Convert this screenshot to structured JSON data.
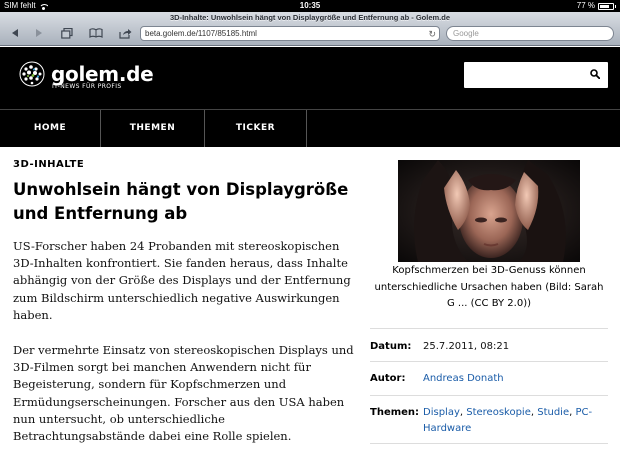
{
  "status_bar": {
    "carrier": "SIM fehlt",
    "time": "10:35",
    "battery_percent": "77 %",
    "battery_level": 0.77,
    "icons": [
      "wifi-icon",
      "battery-icon"
    ]
  },
  "browser": {
    "page_title": "3D-Inhalte: Unwohlsein hängt von Displaygröße und Entfernung ab - Golem.de",
    "url": "beta.golem.de/1107/85185.html",
    "search_placeholder": "Google",
    "buttons": [
      "back-icon",
      "forward-icon",
      "tabs-icon",
      "bookmarks-icon",
      "share-icon",
      "reload-icon"
    ]
  },
  "site": {
    "logo_text": "golem.de",
    "tagline": "IT-NEWS FÜR PROFIS",
    "nav": [
      {
        "label": "HOME"
      },
      {
        "label": "THEMEN"
      },
      {
        "label": "TICKER"
      }
    ],
    "colors": {
      "header_bg": "#000000",
      "link": "#1a5ca8"
    }
  },
  "article": {
    "kicker": "3D-INHALTE",
    "headline": "Unwohlsein hängt von Displaygröße und Entfernung ab",
    "paragraphs": [
      "US-Forscher haben 24 Probanden mit stereoskopischen 3D-Inhalten konfrontiert. Sie fanden heraus, dass Inhalte abhängig von der Größe des Displays und der Entfernung zum Bildschirm unterschiedlich negative Auswirkungen haben.",
      "Der vermehrte Einsatz von stereoskopischen Displays und 3D-Filmen sorgt bei manchen Anwendern nicht für Begeisterung, sondern für Kopfschmerzen und Ermüdungserscheinungen. Forscher aus den USA haben nun untersucht, ob unterschiedliche Betrachtungsabstände dabei eine Rolle spielen."
    ]
  },
  "sidebar": {
    "caption": "Kopfschmerzen bei 3D-Genuss können unterschiedliche Ursachen haben (Bild: Sarah G ... (CC BY 2.0))",
    "meta": {
      "date_label": "Datum:",
      "date_value": "25.7.2011, 08:21",
      "author_label": "Autor:",
      "author_value": "Andreas Donath",
      "topics_label": "Themen:",
      "topics": [
        "Display",
        "Stereoskopie",
        "Studie",
        "PC-Hardware"
      ],
      "topic_separator": ", "
    }
  }
}
